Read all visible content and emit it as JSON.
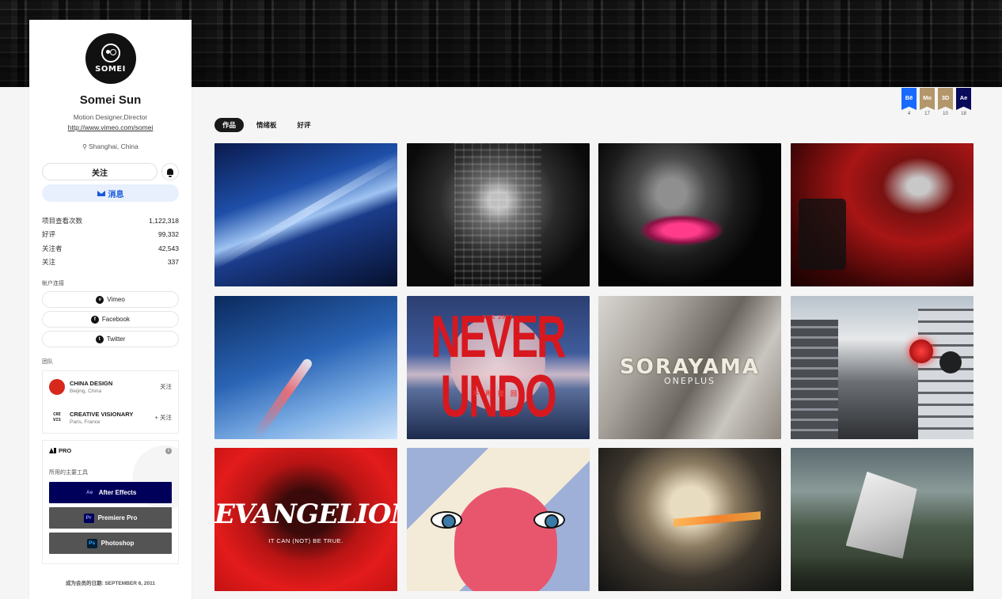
{
  "profile": {
    "name": "Somei Sun",
    "avatar_text": "SOMEI",
    "occupation": "Motion Designer,Director",
    "website": "http://www.vimeo.com/somei",
    "location": "Shanghai, China",
    "follow_label": "关注",
    "message_label": "消息"
  },
  "stats": [
    {
      "label": "项目查看次数",
      "value": "1,122,318"
    },
    {
      "label": "好评",
      "value": "99,332"
    },
    {
      "label": "关注者",
      "value": "42,543"
    },
    {
      "label": "关注",
      "value": "337"
    }
  ],
  "social": {
    "heading": "帐户连接",
    "links": [
      {
        "label": "Vimeo",
        "icon": "vimeo-icon",
        "glyph": "v"
      },
      {
        "label": "Facebook",
        "icon": "facebook-icon",
        "glyph": "f"
      },
      {
        "label": "Twitter",
        "icon": "twitter-icon",
        "glyph": "t"
      }
    ]
  },
  "teams": {
    "heading": "团队",
    "items": [
      {
        "name": "CHINA DESIGN",
        "location": "Beijing, China",
        "action": "关注",
        "logo_text": ""
      },
      {
        "name": "CREATIVE VISIONARY",
        "location": "Paris, France",
        "action": "+ 关注",
        "logo_text": "CRE VIS"
      }
    ]
  },
  "pro": {
    "label": "PRO",
    "tools_heading": "所用的主要工具",
    "tools": [
      {
        "abbr": "Ae",
        "label": "After Effects"
      },
      {
        "abbr": "Pr",
        "label": "Premiere Pro"
      },
      {
        "abbr": "Ps",
        "label": "Photoshop"
      }
    ]
  },
  "member_since": "成为会员的日期: SEPTEMBER 6, 2011",
  "badges": [
    {
      "label": "Bē",
      "count": "4",
      "color": "#1769ff"
    },
    {
      "label": "Mo",
      "count": "17",
      "color": "#b3966a"
    },
    {
      "label": "3D",
      "count": "10",
      "color": "#b3966a"
    },
    {
      "label": "Ae",
      "count": "18",
      "color": "#0a0a5a"
    }
  ],
  "tabs": [
    "作品",
    "情绪板",
    "好评"
  ],
  "projects": {
    "never_undo": {
      "small": "BYE 2020",
      "title": "NEVER UNDO",
      "sub": "不再撤回"
    },
    "sorayama": {
      "title": "SORAYAMA",
      "sub": "ONEPLUS"
    },
    "evangelion": {
      "title": "EVANGELION:",
      "sub": "IT CAN (NOT) BE TRUE."
    }
  }
}
